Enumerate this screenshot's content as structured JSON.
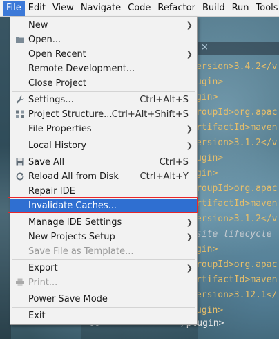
{
  "menubar": {
    "items": [
      "File",
      "Edit",
      "View",
      "Navigate",
      "Code",
      "Refactor",
      "Build",
      "Run",
      "Tools"
    ]
  },
  "editor": {
    "tab_close": "×",
    "lines": [
      "ersion>3.4.2</v",
      "ugin>",
      "gin>",
      "roupId>org.apac",
      "rtifactId>maven",
      "ersion>3.1.2</v",
      "ugin>",
      "gin>",
      "roupId>org.apac",
      "rtifactId>maven",
      "ersion>3.1.2</v",
      " site lifecycle",
      "gin>",
      "roupId>org.apac",
      "rtifactId>maven",
      "ersion>3.12.1</",
      "ugin>"
    ],
    "line_number": "90",
    "close_tag": "</plugin>"
  },
  "file_menu": {
    "items": [
      {
        "label": "New",
        "shortcut": "",
        "submenu": true
      },
      {
        "label": "Open...",
        "shortcut": "",
        "submenu": false
      },
      {
        "label": "Open Recent",
        "shortcut": "",
        "submenu": true
      },
      {
        "label": "Remote Development...",
        "shortcut": "",
        "submenu": false
      },
      {
        "label": "Close Project",
        "shortcut": "",
        "submenu": false
      },
      {
        "label": "Settings...",
        "shortcut": "Ctrl+Alt+S",
        "submenu": false
      },
      {
        "label": "Project Structure...",
        "shortcut": "Ctrl+Alt+Shift+S",
        "submenu": false
      },
      {
        "label": "File Properties",
        "shortcut": "",
        "submenu": true
      },
      {
        "label": "Local History",
        "shortcut": "",
        "submenu": true
      },
      {
        "label": "Save All",
        "shortcut": "Ctrl+S",
        "submenu": false
      },
      {
        "label": "Reload All from Disk",
        "shortcut": "Ctrl+Alt+Y",
        "submenu": false
      },
      {
        "label": "Repair IDE",
        "shortcut": "",
        "submenu": false
      },
      {
        "label": "Invalidate Caches...",
        "shortcut": "",
        "submenu": false
      },
      {
        "label": "Manage IDE Settings",
        "shortcut": "",
        "submenu": true
      },
      {
        "label": "New Projects Setup",
        "shortcut": "",
        "submenu": true
      },
      {
        "label": "Save File as Template...",
        "shortcut": "",
        "submenu": false
      },
      {
        "label": "Export",
        "shortcut": "",
        "submenu": true
      },
      {
        "label": "Print...",
        "shortcut": "",
        "submenu": false
      },
      {
        "label": "Power Save Mode",
        "shortcut": "",
        "submenu": false
      },
      {
        "label": "Exit",
        "shortcut": "",
        "submenu": false
      }
    ]
  },
  "colors": {
    "selection": "#2f6fd1",
    "highlight_frame": "#e8262a",
    "menubar_active": "#3c79d8"
  }
}
